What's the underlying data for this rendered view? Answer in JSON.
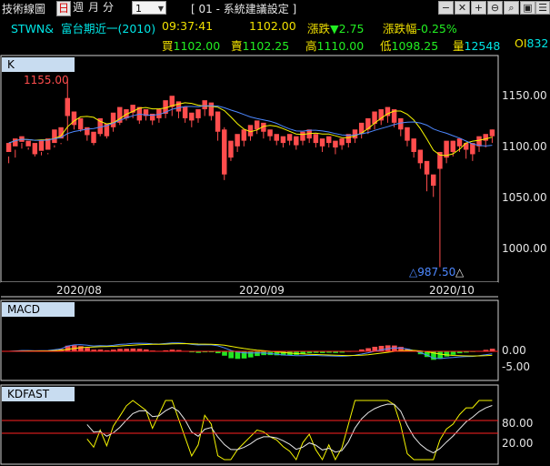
{
  "toolbar": {
    "title": "技術線圖",
    "period_day": "日",
    "period_week": "週",
    "period_month": "月",
    "period_minute": "分",
    "interval_value": "1",
    "window_title": "[ 01 - 系統建議設定 ]",
    "icons": [
      "minus-icon",
      "close-icon",
      "zoom-in-icon",
      "zoom-out-icon",
      "search-icon",
      "save-icon",
      "settings-icon"
    ]
  },
  "quote": {
    "symbol": "STWN&",
    "name": "富台期近一(2010)",
    "time": "09:37:41",
    "price": "1102.00",
    "change_label": "漲跌",
    "change_arrow": "▼",
    "change_value": "2.75",
    "pct_label": "漲跌幅",
    "pct_value": "-0.25%",
    "bid_label": "買",
    "bid_value": "1102.00",
    "ask_label": "賣",
    "ask_value": "1102.25",
    "high_label": "高",
    "high_value": "1110.00",
    "low_label": "低",
    "low_value": "1098.25",
    "volume_label": "量",
    "volume_value": "12548",
    "oi_label": "OI",
    "oi_value": "832"
  },
  "panels": {
    "k_label": "K",
    "macd_label": "MACD",
    "kd_label": "KDFAST"
  },
  "annotations": {
    "high_mark": "1155.00",
    "low_mark": "△987.50"
  },
  "colors": {
    "up": "#ff4d4d",
    "down": "#22e622",
    "ma1": "#f5f500",
    "ma2": "#4d88ff",
    "macd_zero": "#ff2222",
    "kd_k": "#f5f500",
    "kd_d": "#e6e6e6"
  },
  "chart_data": {
    "type": "candlestick",
    "price_axis": {
      "ticks": [
        "1150.00",
        "1100.00",
        "1050.00",
        "1000.00"
      ],
      "range": [
        975,
        1175
      ]
    },
    "x_axis": {
      "ticks": [
        "2020/08",
        "2020/09",
        "2020/10"
      ]
    },
    "macd_axis": {
      "ticks": [
        "0.00",
        "-5.00"
      ]
    },
    "kd_axis": {
      "ticks": [
        "80.00",
        "20.00"
      ]
    },
    "candles": [
      [
        1090,
        1098,
        1086,
        1080
      ],
      [
        1095,
        1102,
        1092,
        1085
      ],
      [
        1099,
        1104,
        1098,
        1093
      ],
      [
        1095,
        1100,
        1094,
        1092
      ],
      [
        1088,
        1098,
        1086,
        1092
      ],
      [
        1091,
        1100,
        1087,
        1090
      ],
      [
        1092,
        1102,
        1088,
        1089
      ],
      [
        1098,
        1110,
        1096,
        1094
      ],
      [
        1102,
        1112,
        1098,
        1097
      ],
      [
        1122,
        1138,
        1155,
        1100
      ],
      [
        1114,
        1126,
        1120,
        1110
      ],
      [
        1110,
        1120,
        1118,
        1108
      ],
      [
        1105,
        1112,
        1110,
        1100
      ],
      [
        1098,
        1108,
        1104,
        1096
      ],
      [
        1106,
        1120,
        1116,
        1104
      ],
      [
        1104,
        1115,
        1112,
        1102
      ],
      [
        1112,
        1125,
        1118,
        1108
      ],
      [
        1116,
        1130,
        1125,
        1114
      ],
      [
        1120,
        1128,
        1126,
        1118
      ],
      [
        1125,
        1132,
        1128,
        1120
      ],
      [
        1118,
        1130,
        1128,
        1115
      ],
      [
        1122,
        1128,
        1125,
        1118
      ],
      [
        1118,
        1124,
        1122,
        1114
      ],
      [
        1120,
        1128,
        1125,
        1116
      ],
      [
        1124,
        1136,
        1130,
        1120
      ],
      [
        1130,
        1140,
        1132,
        1122
      ],
      [
        1126,
        1135,
        1130,
        1120
      ],
      [
        1120,
        1130,
        1128,
        1116
      ],
      [
        1118,
        1125,
        1122,
        1112
      ],
      [
        1120,
        1128,
        1125,
        1116
      ],
      [
        1128,
        1136,
        1132,
        1122
      ],
      [
        1122,
        1134,
        1130,
        1118
      ],
      [
        1108,
        1126,
        1122,
        1100
      ],
      [
        1070,
        1110,
        1112,
        1065
      ],
      [
        1085,
        1100,
        1098,
        1082
      ],
      [
        1095,
        1106,
        1102,
        1090
      ],
      [
        1100,
        1110,
        1108,
        1095
      ],
      [
        1104,
        1114,
        1112,
        1100
      ],
      [
        1110,
        1118,
        1115,
        1106
      ],
      [
        1108,
        1116,
        1112,
        1102
      ],
      [
        1104,
        1110,
        1108,
        1100
      ],
      [
        1100,
        1106,
        1104,
        1096
      ],
      [
        1098,
        1104,
        1102,
        1094
      ],
      [
        1100,
        1106,
        1104,
        1096
      ],
      [
        1096,
        1104,
        1100,
        1092
      ],
      [
        1100,
        1108,
        1104,
        1096
      ],
      [
        1102,
        1110,
        1106,
        1098
      ],
      [
        1098,
        1106,
        1104,
        1094
      ],
      [
        1095,
        1102,
        1100,
        1090
      ],
      [
        1098,
        1104,
        1102,
        1094
      ],
      [
        1094,
        1100,
        1098,
        1088
      ],
      [
        1096,
        1102,
        1100,
        1092
      ],
      [
        1098,
        1106,
        1104,
        1094
      ],
      [
        1102,
        1110,
        1108,
        1098
      ],
      [
        1106,
        1116,
        1112,
        1102
      ],
      [
        1110,
        1120,
        1118,
        1106
      ],
      [
        1115,
        1126,
        1122,
        1110
      ],
      [
        1118,
        1128,
        1125,
        1114
      ],
      [
        1122,
        1130,
        1128,
        1116
      ],
      [
        1116,
        1128,
        1124,
        1112
      ],
      [
        1110,
        1120,
        1118,
        1104
      ],
      [
        1100,
        1112,
        1110,
        1095
      ],
      [
        1090,
        1102,
        1100,
        1085
      ],
      [
        1080,
        1092,
        1090,
        1075
      ],
      [
        1070,
        1082,
        1080,
        1055
      ],
      [
        1060,
        1070,
        1068,
        1050
      ],
      [
        1075,
        1090,
        1090,
        987.5
      ],
      [
        1085,
        1100,
        1098,
        1080
      ],
      [
        1090,
        1100,
        1100,
        1086
      ],
      [
        1095,
        1102,
        1100,
        1090
      ],
      [
        1092,
        1098,
        1098,
        1084
      ],
      [
        1088,
        1098,
        1098,
        1082
      ],
      [
        1095,
        1104,
        1102,
        1090
      ],
      [
        1100,
        1106,
        1104,
        1094
      ],
      [
        1104,
        1110,
        1110,
        1098
      ]
    ]
  }
}
